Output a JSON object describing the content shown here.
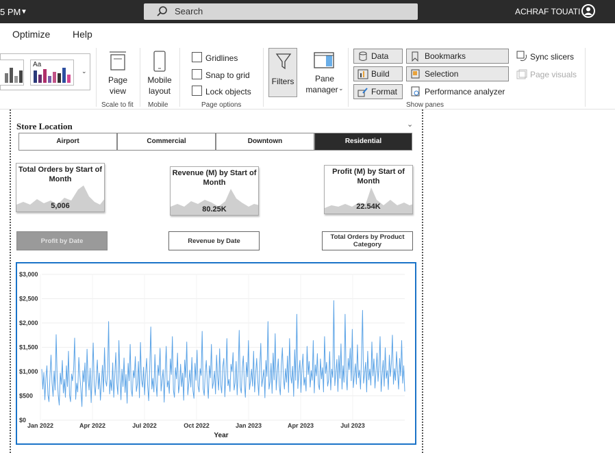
{
  "titlebar": {
    "time_fragment": "5 PM",
    "search_placeholder": "Search",
    "user_name": "ACHRAF TOUATI"
  },
  "menu": {
    "items": [
      "Optimize",
      "Help"
    ]
  },
  "ribbon": {
    "scale_to_fit": {
      "page_view_label": "Page",
      "page_view_label2": "view",
      "group_label": "Scale to fit"
    },
    "mobile": {
      "label": "Mobile",
      "label2": "layout",
      "group_label": "Mobile"
    },
    "page_options": {
      "gridlines": "Gridlines",
      "snap_to_grid": "Snap to grid",
      "lock_objects": "Lock objects",
      "group_label": "Page options"
    },
    "filters_label": "Filters",
    "pane_manager": {
      "label": "Pane",
      "label2": "manager"
    },
    "show_panes": {
      "data": "Data",
      "build": "Build",
      "format": "Format",
      "bookmarks": "Bookmarks",
      "selection": "Selection",
      "performance_analyzer": "Performance analyzer",
      "sync_slicers": "Sync slicers",
      "page_visuals": "Page visuals",
      "group_label": "Show panes"
    }
  },
  "slicer": {
    "title": "Store Location",
    "options": [
      "Airport",
      "Commercial",
      "Downtown",
      "Residential"
    ],
    "selected": "Residential"
  },
  "cards": [
    {
      "title": "Total Orders by Start of Month",
      "value": "5,006"
    },
    {
      "title": "Revenue (M) by Start of Month",
      "value": "80.25K"
    },
    {
      "title": "Profit (M) by Start of Month",
      "value": "22.54K"
    }
  ],
  "nav_buttons": [
    {
      "label": "Profit by Date",
      "state": "disabled"
    },
    {
      "label": "Revenue by Date",
      "state": "normal"
    },
    {
      "label": "Total Orders by Product Category",
      "state": "normal"
    }
  ],
  "colors": {
    "line": "#5ba3e6",
    "selected_slicer": "#2b2b2b",
    "chart_border": "#1a73c8",
    "titlebar": "#2b2b2b"
  },
  "chart_data": {
    "type": "line",
    "xlabel": "Year",
    "ylabel": "",
    "x_ticks": [
      "Jan 2022",
      "Apr 2022",
      "Jul 2022",
      "Oct 2022",
      "Jan 2023",
      "Apr 2023",
      "Jul 2023"
    ],
    "y_ticks": [
      "$0",
      "$500",
      "$1,000",
      "$1,500",
      "$2,000",
      "$2,500",
      "$3,000"
    ],
    "ylim": [
      0,
      3000
    ],
    "x_range": [
      "2022-01-01",
      "2023-10-31"
    ],
    "grid": true,
    "series": [
      {
        "values": [
          1050,
          640,
          980,
          420,
          860,
          1120,
          520,
          380,
          910,
          1340,
          760,
          490,
          1010,
          620,
          1760,
          880,
          520,
          310,
          970,
          740,
          1230,
          560,
          840,
          470,
          1120,
          690,
          1420,
          520,
          380,
          950,
          810,
          1050,
          1690,
          430,
          760,
          580,
          1290,
          910,
          640,
          280,
          1020,
          790,
          1180,
          490,
          1460,
          850,
          620,
          1070,
          360,
          930,
          1590,
          720,
          510,
          880,
          1240,
          640,
          970,
          410,
          760,
          1130,
          580,
          1490,
          820,
          700,
          960,
          2030,
          540,
          830,
          610,
          1180,
          470,
          920,
          1390,
          760,
          530,
          1640,
          880,
          420,
          1050,
          690,
          1280,
          570,
          940,
          350,
          1170,
          810,
          1560,
          630,
          490,
          1020,
          870,
          1310,
          590,
          740,
          1210,
          460,
          1600,
          830,
          680,
          1090,
          520,
          950,
          1270,
          710,
          400,
          1050,
          1920,
          640,
          860,
          580,
          1350,
          770,
          490,
          1130,
          920,
          1480,
          600,
          830,
          1040,
          370,
          990,
          1520,
          680,
          810,
          550,
          1260,
          940,
          1720,
          620,
          470,
          1080,
          850,
          1380,
          560,
          730,
          1150,
          690,
          970,
          410,
          1240,
          880,
          1610,
          520,
          760,
          1030,
          680,
          1290,
          610,
          450,
          1170,
          820,
          1440,
          700,
          580,
          1060,
          920,
          1830,
          640,
          510,
          980,
          1230,
          760,
          450,
          1120,
          870,
          1560,
          650,
          780,
          1010,
          540,
          1340,
          890,
          620,
          1470,
          730,
          560,
          1090,
          1270,
          480,
          930,
          1680,
          710,
          840,
          590,
          1150,
          1000,
          1390,
          620,
          770,
          1210,
          520,
          990,
          1850,
          680,
          560,
          1080,
          1320,
          740,
          470,
          1190,
          890,
          1640,
          630,
          810,
          1050,
          700,
          1420,
          580,
          960,
          1270,
          820,
          510,
          1110,
          1580,
          690,
          860,
          1040,
          460,
          1230,
          900,
          2030,
          640,
          790,
          1170,
          550,
          1380,
          830,
          1780,
          620,
          970,
          1260,
          710,
          520,
          1140,
          1490,
          880,
          640,
          1060,
          780,
          1320,
          570,
          1680,
          930,
          760,
          1110,
          490,
          1450,
          820,
          2180,
          650,
          990,
          1230,
          570,
          1050,
          1360,
          720,
          880,
          600,
          1520,
          940,
          1210,
          680,
          1020,
          820,
          1640,
          560,
          1140,
          910,
          1370,
          740,
          630,
          1260,
          850,
          1080,
          580,
          1720,
          960,
          1190,
          700,
          830,
          1410,
          620,
          1050,
          880,
          2460,
          710,
          970,
          1250,
          590,
          1330,
          860,
          1570,
          640,
          1120,
          780,
          2180,
          900,
          620,
          1270,
          1040,
          1480,
          810,
          1870,
          670,
          930,
          1160,
          740,
          1550,
          870,
          1030,
          640,
          1290,
          2260,
          760,
          960,
          1190,
          580,
          1420,
          830,
          1050,
          720,
          1610,
          910,
          1260,
          660,
          1000,
          1380,
          800,
          1130,
          1720,
          590,
          950,
          1230,
          700,
          1490,
          860,
          1020,
          630,
          1340,
          900,
          1180,
          1750,
          740,
          1060,
          820,
          1410,
          980,
          640,
          1270,
          910,
          1640,
          760,
          1120,
          590
        ]
      }
    ]
  }
}
